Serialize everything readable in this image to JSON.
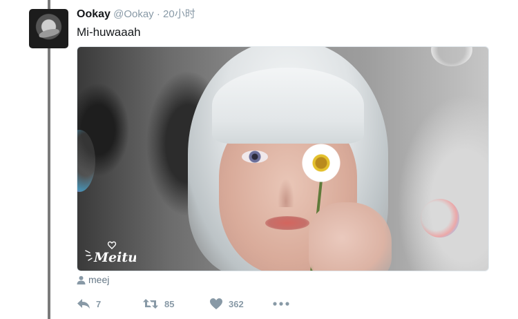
{
  "tweet": {
    "display_name": "Ookay",
    "handle": "@Ookay",
    "separator": "·",
    "timestamp": "20小时",
    "text": "Mi-huwaaah",
    "media": {
      "watermark_text": "Meitu"
    },
    "tagged_user": "meej",
    "actions": {
      "reply_count": "7",
      "retweet_count": "85",
      "like_count": "362"
    }
  },
  "icons": {
    "reply": "reply-arrow-icon",
    "retweet": "retweet-icon",
    "like": "heart-icon",
    "more": "more-dots-icon",
    "person": "person-icon"
  },
  "colors": {
    "text": "#14171a",
    "secondary": "#8899a6",
    "thread_line": "#7a7a7a"
  }
}
